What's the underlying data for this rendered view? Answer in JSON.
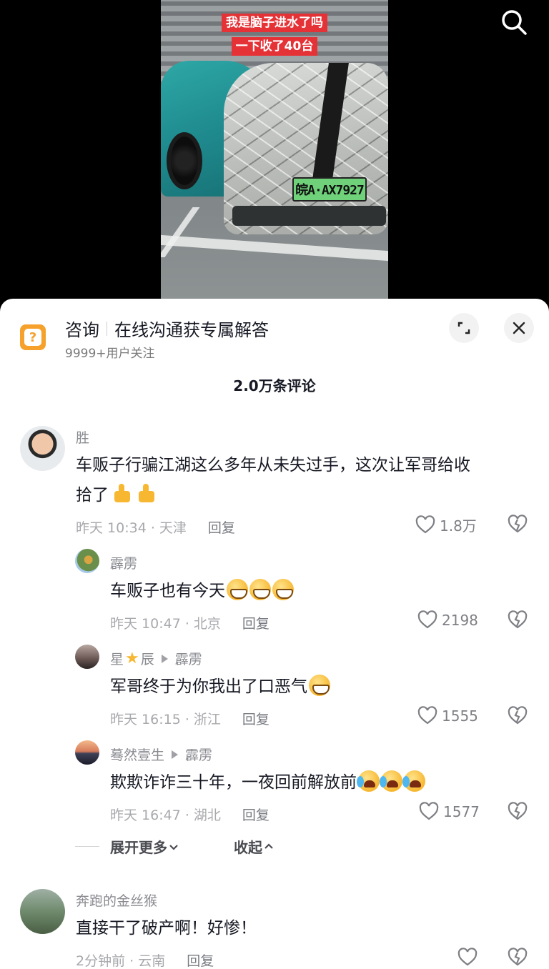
{
  "video": {
    "caption_line1": "我是脑子进水了吗",
    "caption_line2": "一下收了40台",
    "plate": "皖A·AX7927"
  },
  "consult": {
    "title": "咨询",
    "tagline": "在线沟通获专属解答",
    "followers": "9999+用户关注"
  },
  "comments_count": "2.0万条评论",
  "comments": [
    {
      "user": "胜",
      "text_line1": "车贩子行骗江湖这么多年从未失过手，这次让军哥给收",
      "text_line2": "拾了",
      "time_loc": "昨天 10:34 · 天津",
      "reply_label": "回复",
      "likes": "1.8万"
    },
    {
      "user": "霹雳",
      "text": "车贩子也有今天",
      "time_loc": "昨天 10:47 · 北京",
      "reply_label": "回复",
      "likes": "2198"
    },
    {
      "user_a": "星",
      "user_b": "辰",
      "reply_to": "霹雳",
      "text": "军哥终于为你我出了口恶气",
      "time_loc": "昨天 16:15 · 浙江",
      "reply_label": "回复",
      "likes": "1555"
    },
    {
      "user": "蓦然壹生",
      "reply_to": "霹雳",
      "text": "欺欺诈诈三十年，一夜回前解放前",
      "time_loc": "昨天 16:47 · 湖北",
      "reply_label": "回复",
      "likes": "1577"
    },
    {
      "user": "奔跑的金丝猴",
      "text": "直接干了破产啊！好惨！",
      "time_loc": "2分钟前 · 云南",
      "reply_label": "回复",
      "likes": ""
    }
  ],
  "thread_controls": {
    "expand_label": "展开更多",
    "collapse_label": "收起"
  },
  "colors": {
    "caption_bg": "#e53237",
    "consult_icon": "#f5a12c",
    "secondary_text": "#a8a9ad"
  }
}
